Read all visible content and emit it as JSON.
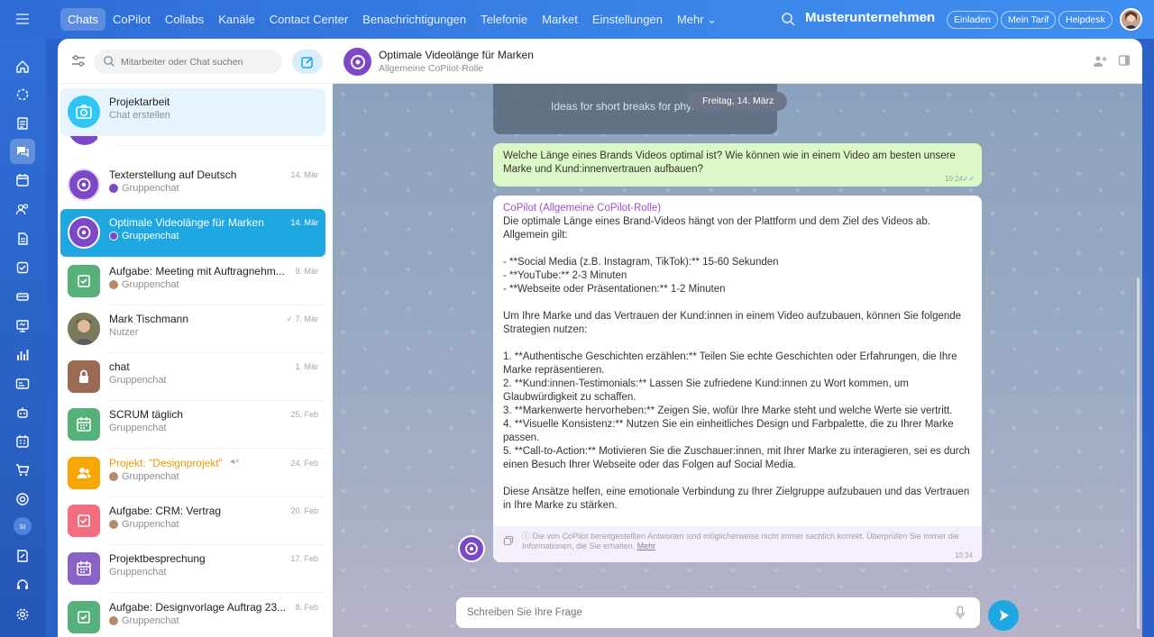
{
  "topbar": {
    "nav": [
      "Chats",
      "CoPilot",
      "Collabs",
      "Kanäle",
      "Contact Center",
      "Benachrichtigungen",
      "Telefonie",
      "Market",
      "Einstellungen",
      "Mehr ⌄"
    ],
    "company": "Musterunternehmen",
    "invite": "Einladen",
    "plan": "Mein Tarif",
    "helpdesk": "Helpdesk"
  },
  "rail": {
    "user_initials": "SI"
  },
  "sidebar": {
    "search_placeholder": "Mitarbeiter oder Chat suchen",
    "chats": [
      {
        "name": "Projektarbeit",
        "sub": "Chat erstellen",
        "date": "",
        "kind": "new"
      },
      {
        "name": "Texterstellung auf Deutsch",
        "sub": "Gruppenchat",
        "date": "14. Mär",
        "kind": "copilot"
      },
      {
        "name": "Optimale Videolänge für Marken",
        "sub": "Gruppenchat",
        "date": "14. Mär",
        "kind": "copilot"
      },
      {
        "name": "Aufgabe: Meeting mit Auftragnehm...",
        "sub": "Gruppenchat",
        "date": "9. Mär",
        "kind": "task"
      },
      {
        "name": "Mark Tischmann",
        "sub": "Nutzer",
        "date": "✓ 7. Mär",
        "kind": "user"
      },
      {
        "name": "chat",
        "sub": "Gruppenchat",
        "date": "1. Mär",
        "kind": "lock"
      },
      {
        "name": "SCRUM täglich",
        "sub": "Gruppenchat",
        "date": "25. Feb",
        "kind": "calendar"
      },
      {
        "name": "Projekt: \"Designprojekt\"",
        "sub": "Gruppenchat",
        "date": "24. Feb",
        "kind": "project"
      },
      {
        "name": "Aufgabe: CRM: Vertrag",
        "sub": "Gruppenchat",
        "date": "20. Feb",
        "kind": "task-pink"
      },
      {
        "name": "Projektbesprechung",
        "sub": "Gruppenchat",
        "date": "17. Feb",
        "kind": "calendar-purple"
      },
      {
        "name": "Aufgabe: Designvorlage Auftrag 23...",
        "sub": "Gruppenchat",
        "date": "8. Feb",
        "kind": "task"
      }
    ]
  },
  "chat": {
    "title": "Optimale Videolänge für Marken",
    "subtitle": "Allgemeine CoPilot-Rolle",
    "previous_message": "Ideas for short breaks for physical",
    "date_pill": "Freitag, 14. März",
    "user_message": "Welche Länge eines Brands Videos optimal ist? Wie können wie in einem Video am besten unsere Marke und Kund:innenvertrauen aufbauen?",
    "user_time": "10:24",
    "bot_author": "CoPilot (Allgemeine CoPilot-Rolle)",
    "bot_text": "Die optimale Länge eines Brand-Videos hängt von der Plattform und dem Ziel des Videos ab. Allgemein gilt:\n\n- **Social Media (z.B. Instagram, TikTok):** 15-60 Sekunden\n- **YouTube:** 2-3 Minuten\n- **Webseite oder Präsentationen:** 1-2 Minuten\n\nUm Ihre Marke und das Vertrauen der Kund:innen in einem Video aufzubauen, können Sie folgende Strategien nutzen:\n\n1. **Authentische Geschichten erzählen:** Teilen Sie echte Geschichten oder Erfahrungen, die Ihre Marke repräsentieren.\n2. **Kund:innen-Testimonials:** Lassen Sie zufriedene Kund:innen zu Wort kommen, um Glaubwürdigkeit zu schaffen.\n3. **Markenwerte hervorheben:** Zeigen Sie, wofür Ihre Marke steht und welche Werte sie vertritt.\n4. **Visuelle Konsistenz:** Nutzen Sie ein einheitliches Design und Farbpalette, die zu Ihrer Marke passen.\n5. **Call-to-Action:** Motivieren Sie die Zuschauer:innen, mit Ihrer Marke zu interagieren, sei es durch einen Besuch Ihrer Webseite oder das Folgen auf Social Media.\n\nDiese Ansätze helfen, eine emotionale Verbindung zu Ihrer Zielgruppe aufzubauen und das Vertrauen in Ihre Marke zu stärken.",
    "disclaimer": "ⓘ Die von CoPilot bereitgestellten Antworten sind möglicherweise nicht immer sachlich korrekt. Überprüfen Sie immer die Informationen, die Sie erhalten.",
    "disclaimer_link": "Mehr",
    "bot_time": "10:24",
    "input_placeholder": "Schreiben Sie Ihre Frage"
  },
  "colors": {
    "accent": "#1ea7e1",
    "copilot": "#7d48c8",
    "user_bubble": "#dcf8c6"
  }
}
